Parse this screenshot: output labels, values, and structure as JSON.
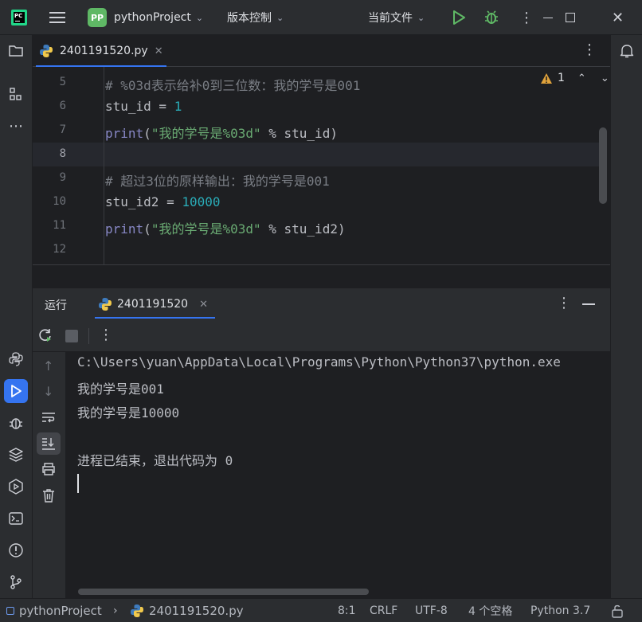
{
  "titlebar": {
    "project_badge": "PP",
    "project_name": "pythonProject",
    "vcs_label": "版本控制",
    "run_config": "当前文件"
  },
  "editor_tab": {
    "label": "2401191520.py"
  },
  "inspection": {
    "warning_count": "1"
  },
  "code_lines": [
    {
      "num": "5",
      "tokens": [
        {
          "t": "# %03d表示给补0到三位数：我的学号是001",
          "c": "c-com"
        }
      ]
    },
    {
      "num": "6",
      "tokens": [
        {
          "t": "stu_id = ",
          "c": "c-def"
        },
        {
          "t": "1",
          "c": "c-num"
        }
      ]
    },
    {
      "num": "7",
      "tokens": [
        {
          "t": "print",
          "c": "c-fn"
        },
        {
          "t": "(",
          "c": "c-def"
        },
        {
          "t": "\"我的学号是%03d\"",
          "c": "c-str"
        },
        {
          "t": " % stu_id)",
          "c": "c-def"
        }
      ]
    },
    {
      "num": "8",
      "tokens": []
    },
    {
      "num": "9",
      "tokens": [
        {
          "t": "# 超过3位的原样输出：我的学号是001",
          "c": "c-com"
        }
      ]
    },
    {
      "num": "10",
      "tokens": [
        {
          "t": "stu_id2 = ",
          "c": "c-def"
        },
        {
          "t": "10000",
          "c": "c-num"
        }
      ]
    },
    {
      "num": "11",
      "tokens": [
        {
          "t": "print",
          "c": "c-fn"
        },
        {
          "t": "(",
          "c": "c-def"
        },
        {
          "t": "\"我的学号是%03d\"",
          "c": "c-str"
        },
        {
          "t": " % stu_id2)",
          "c": "c-def"
        }
      ]
    },
    {
      "num": "12",
      "tokens": []
    }
  ],
  "current_line": "8",
  "run_panel": {
    "title": "运行",
    "tab_label": "2401191520"
  },
  "console_lines": [
    "C:\\Users\\yuan\\AppData\\Local\\Programs\\Python\\Python37\\python.exe",
    "我的学号是001",
    "我的学号是10000",
    "",
    "进程已结束，退出代码为 0"
  ],
  "statusbar": {
    "project": "pythonProject",
    "file": "2401191520.py",
    "position": "8:1",
    "line_sep": "CRLF",
    "encoding": "UTF-8",
    "indent": "4 个空格",
    "interpreter": "Python 3.7"
  },
  "colors": {
    "accent": "#3574f0",
    "project_badge": "#5fb865",
    "run_green": "#5fb865",
    "warning": "#e0a23b"
  }
}
